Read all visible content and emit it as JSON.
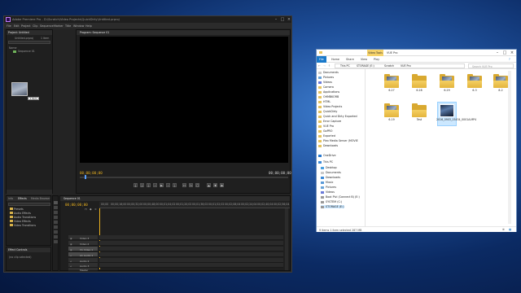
{
  "premiere": {
    "title": "Adobe Premiere Pro - D:\\Scratch\\Video Projects\\QuickDirty\\Untitled.prproj",
    "menu": [
      "File",
      "Edit",
      "Project",
      "Clip",
      "Sequence",
      "Marker",
      "Title",
      "Window",
      "Help"
    ],
    "project_panel": {
      "tab": "Project: Untitled",
      "file": "Untitled.prproj",
      "item_count": "1 Item",
      "name_header": "Name",
      "sequence_item": "Sequence 01",
      "drag_tooltip": "1 Item"
    },
    "program_monitor": {
      "tab": "Program: Sequence 01",
      "timecode_left": "00;00;00;00",
      "timecode_right": "00;00;00;00"
    },
    "effects_panel": {
      "tabs": [
        "Info",
        "Effects",
        "Media Browser"
      ],
      "items": [
        "Presets",
        "Audio Effects",
        "Audio Transitions",
        "Video Effects",
        "Video Transitions"
      ]
    },
    "effect_controls": {
      "tab": "Effect Controls",
      "text": "(no clip selected)"
    },
    "timeline": {
      "tab": "Sequence 01",
      "timecode": "00;00;00;00",
      "ruler": [
        "00;00",
        "00;00;16;00",
        "00;00;32;00",
        "00;00;48;00",
        "00;01;04;02",
        "00;01;20;02",
        "00;01;36;02",
        "00;01;52;02",
        "00;02;08;04",
        "00;02;24;04",
        "00;02;40;04",
        "00;02;56;04"
      ],
      "tracks": [
        "Video 3",
        "Video 2",
        "V1 Video 1",
        "A1 Audio 1",
        "Audio 2",
        "Audio 3",
        "Master"
      ]
    }
  },
  "explorer": {
    "tab_context": "Video Tools",
    "title": "VUE Pro",
    "ribbon": [
      "File",
      "Home",
      "Share",
      "View",
      "Play"
    ],
    "address": [
      "This PC",
      "STORAGE (E:)",
      "Scratch",
      "VUE Pro"
    ],
    "search_placeholder": "Search VUE Pro",
    "nav": [
      "Documents",
      "Pictures",
      "Videos",
      "Camera",
      "Applications",
      "OHMBKORB",
      "HTML",
      "Video Projects",
      "QuickDirty",
      "Quick and Dirty Exported",
      "Error Capture",
      "VUE Pro",
      "GoPRO",
      "Exported",
      "Plex Media Server (MOVIE",
      "Downloads",
      "OneDrive",
      "This PC",
      "Desktop",
      "Documents",
      "Downloads",
      "Music",
      "Pictures",
      "Videos",
      "Boot Plvl (Connect B) (E:)",
      "SYSTEM (C:)",
      "STORAGE (E:)"
    ],
    "items": [
      "6-27",
      "6-28",
      "6-29",
      "6-3",
      "8-2",
      "6-19",
      "Test",
      "2016_0903_15434_0001A.MP4"
    ],
    "status": "9 items    1 item selected  287 MB"
  },
  "colors": {
    "accent_premiere": "#e8b020",
    "explorer_selection": "#cce8ff",
    "folder": "#e4b43c"
  }
}
